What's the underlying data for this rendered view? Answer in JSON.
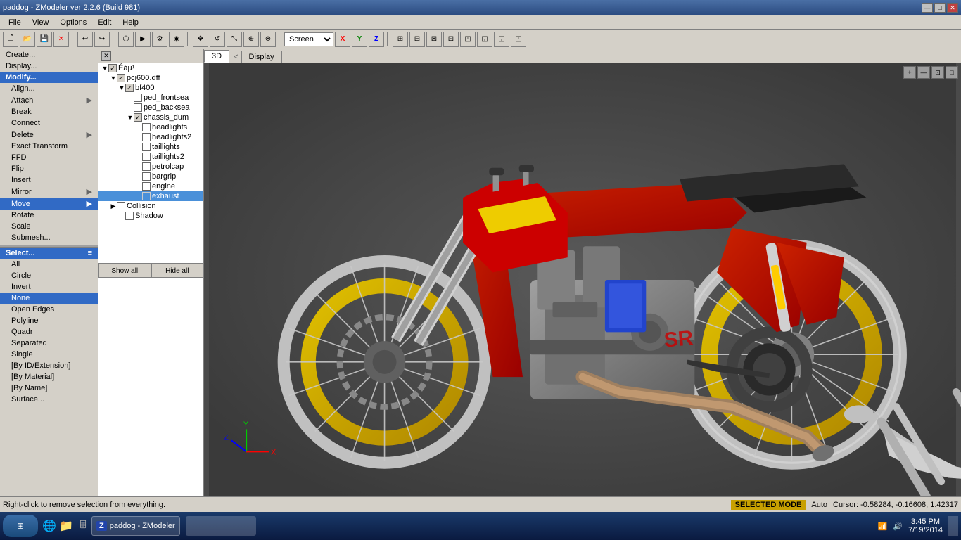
{
  "window": {
    "title": "paddog - ZModeler ver 2.2.6 (Build 981)",
    "controls": [
      "—",
      "□",
      "✕"
    ]
  },
  "menubar": {
    "items": [
      "File",
      "View",
      "Options",
      "Edit",
      "Help"
    ]
  },
  "toolbar": {
    "dropdowns": [
      {
        "value": "Screen"
      }
    ],
    "axis_labels": [
      "X",
      "Y",
      "Z"
    ]
  },
  "left_panel": {
    "sections": [
      {
        "id": "modify",
        "items": [
          {
            "label": "Create...",
            "active": false
          },
          {
            "label": "Display...",
            "active": false
          },
          {
            "label": "Modify...",
            "active": true,
            "is_header": true
          },
          {
            "label": "Align...",
            "active": false
          },
          {
            "label": "Attach",
            "active": false,
            "has_arrow": true
          },
          {
            "label": "Break",
            "active": false
          },
          {
            "label": "Connect",
            "active": false
          },
          {
            "label": "Delete",
            "active": false,
            "has_arrow": true
          },
          {
            "label": "Exact Transform",
            "active": false
          },
          {
            "label": "FFD",
            "active": false
          },
          {
            "label": "Flip",
            "active": false
          },
          {
            "label": "Insert",
            "active": false
          },
          {
            "label": "Mirror",
            "active": false,
            "has_arrow": true
          },
          {
            "label": "Move",
            "active": true
          },
          {
            "label": "Rotate",
            "active": false
          },
          {
            "label": "Scale",
            "active": false
          },
          {
            "label": "Submesh...",
            "active": false
          }
        ]
      },
      {
        "id": "select",
        "items": [
          {
            "label": "Select...",
            "active": true,
            "is_header": true
          },
          {
            "label": "All",
            "active": false
          },
          {
            "label": "Circle",
            "active": false
          },
          {
            "label": "Invert",
            "active": false
          },
          {
            "label": "None",
            "active": true
          },
          {
            "label": "Open Edges",
            "active": false
          },
          {
            "label": "Polyline",
            "active": false
          },
          {
            "label": "Quadr",
            "active": false
          },
          {
            "label": "Separated",
            "active": false
          },
          {
            "label": "Single",
            "active": false
          },
          {
            "label": "[By ID/Extension]",
            "active": false
          },
          {
            "label": "[By Material]",
            "active": false
          },
          {
            "label": "[By Name]",
            "active": false
          },
          {
            "label": "Surface...",
            "active": false
          }
        ]
      }
    ]
  },
  "tree": {
    "title": "Éáµ¹",
    "items": [
      {
        "label": "Éáµ¹",
        "level": 0,
        "checked": true,
        "expanded": true,
        "type": "root"
      },
      {
        "label": "pcj600.dff",
        "level": 1,
        "checked": true,
        "expanded": true,
        "type": "file"
      },
      {
        "label": "bf400",
        "level": 2,
        "checked": true,
        "expanded": true,
        "type": "mesh"
      },
      {
        "label": "ped_frontsea",
        "level": 3,
        "checked": false,
        "type": "item"
      },
      {
        "label": "ped_backsea",
        "level": 3,
        "checked": false,
        "type": "item"
      },
      {
        "label": "chassis_dum",
        "level": 3,
        "checked": true,
        "expanded": true,
        "type": "item"
      },
      {
        "label": "headlights",
        "level": 4,
        "checked": false,
        "type": "item"
      },
      {
        "label": "headlights2",
        "level": 4,
        "checked": false,
        "type": "item"
      },
      {
        "label": "taillights",
        "level": 4,
        "checked": false,
        "type": "item"
      },
      {
        "label": "taillights2",
        "level": 4,
        "checked": false,
        "type": "item"
      },
      {
        "label": "petrolcap",
        "level": 4,
        "checked": false,
        "type": "item"
      },
      {
        "label": "bargrip",
        "level": 4,
        "checked": false,
        "type": "item"
      },
      {
        "label": "engine",
        "level": 4,
        "checked": false,
        "type": "item"
      },
      {
        "label": "exhaust",
        "level": 4,
        "checked": false,
        "type": "item",
        "selected": true
      },
      {
        "label": "Collision",
        "level": 1,
        "checked": false,
        "expanded": false,
        "type": "group"
      },
      {
        "label": "Shadow",
        "level": 2,
        "checked": false,
        "type": "item"
      }
    ],
    "buttons": [
      "Show all",
      "Hide all"
    ]
  },
  "viewport": {
    "tabs": [
      "3D",
      "Display"
    ],
    "active_tab": "3D"
  },
  "statusbar": {
    "left_text": "Right-click to remove selection from everything.",
    "mode": "SELECTED MODE",
    "auto_label": "Auto",
    "cursor": "Cursor: -0.58284, -0.16608, 1.42317"
  },
  "taskbar": {
    "start_icon": "⊞",
    "items": [
      {
        "label": "paddog - ZModeler",
        "icon": "Z",
        "active": true
      }
    ],
    "tray": {
      "time": "3:45 PM",
      "date": "7/19/2014"
    }
  }
}
